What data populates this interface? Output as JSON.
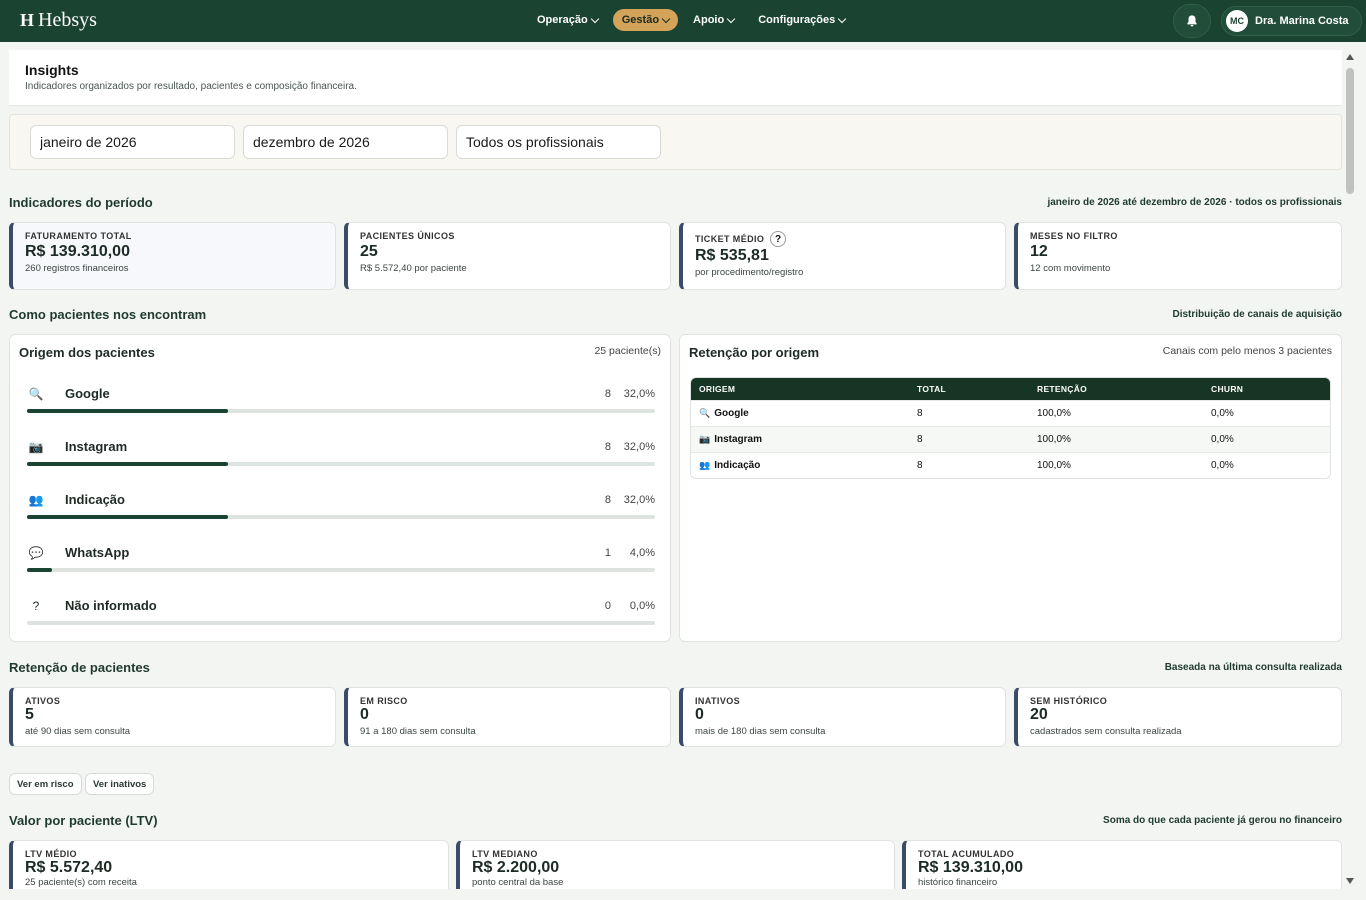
{
  "app": {
    "brand": "Hebsys",
    "brand_mark": "H",
    "nav": [
      {
        "label": "Operação"
      },
      {
        "label": "Gestão"
      },
      {
        "label": "Apoio"
      },
      {
        "label": "Configurações"
      }
    ],
    "user": {
      "initials": "MC",
      "name": "Dra. Marina Costa"
    }
  },
  "colors": {
    "brand": "#1b4332",
    "accent": "#d4a35a"
  },
  "header": {
    "title": "Insights",
    "subtitle": "Indicadores organizados por resultado, pacientes e composição financeira."
  },
  "filters": {
    "start": "janeiro de 2026",
    "end": "dezembro de 2026",
    "professional": "Todos os profissionais"
  },
  "period": {
    "title": "Indicadores do período",
    "note": "janeiro de 2026 até dezembro de 2026 · todos os profissionais",
    "kpis": [
      {
        "label": "FATURAMENTO TOTAL",
        "value": "R$ 139.310,00",
        "sub": "260 registros financeiros"
      },
      {
        "label": "PACIENTES ÚNICOS",
        "value": "25",
        "sub": "R$ 5.572,40 por paciente"
      },
      {
        "label": "TICKET MÉDIO",
        "help": "?",
        "value": "R$ 535,81",
        "sub": "por procedimento/registro"
      },
      {
        "label": "MESES NO FILTRO",
        "value": "12",
        "sub": "12 com movimento"
      }
    ]
  },
  "acquisition": {
    "title": "Como pacientes nos encontram",
    "note": "Distribuição de canais de aquisição",
    "origins": {
      "title": "Origem dos pacientes",
      "meta": "25 paciente(s)",
      "items": [
        {
          "icon": "🔍",
          "icon_name": "search-icon",
          "name": "Google",
          "count": "8",
          "pct": "32,0%",
          "share": 0.32
        },
        {
          "icon": "📷",
          "icon_name": "camera-icon",
          "name": "Instagram",
          "count": "8",
          "pct": "32,0%",
          "share": 0.32
        },
        {
          "icon": "👥",
          "icon_name": "people-icon",
          "name": "Indicação",
          "count": "8",
          "pct": "32,0%",
          "share": 0.32
        },
        {
          "icon": "💬",
          "icon_name": "chat-icon",
          "name": "WhatsApp",
          "count": "1",
          "pct": "4,0%",
          "share": 0.04
        },
        {
          "icon": "?",
          "icon_name": "question-icon",
          "name": "Não informado",
          "count": "0",
          "pct": "0,0%",
          "share": 0.0
        }
      ]
    },
    "retention": {
      "title": "Retenção por origem",
      "meta": "Canais com pelo menos 3 pacientes",
      "columns": [
        "ORIGEM",
        "TOTAL",
        "RETENÇÃO",
        "CHURN"
      ],
      "rows": [
        {
          "icon": "🔍",
          "name": "Google",
          "total": "8",
          "retention": "100,0%",
          "churn": "0,0%"
        },
        {
          "icon": "📷",
          "name": "Instagram",
          "total": "8",
          "retention": "100,0%",
          "churn": "0,0%"
        },
        {
          "icon": "👥",
          "name": "Indicação",
          "total": "8",
          "retention": "100,0%",
          "churn": "0,0%"
        }
      ]
    }
  },
  "patient_retention": {
    "title": "Retenção de pacientes",
    "note": "Baseada na última consulta realizada",
    "kpis": [
      {
        "label": "ATIVOS",
        "value": "5",
        "sub": "até 90 dias sem consulta"
      },
      {
        "label": "EM RISCO",
        "value": "0",
        "sub": "91 a 180 dias sem consulta"
      },
      {
        "label": "INATIVOS",
        "value": "0",
        "sub": "mais de 180 dias sem consulta"
      },
      {
        "label": "SEM HISTÓRICO",
        "value": "20",
        "sub": "cadastrados sem consulta realizada"
      }
    ],
    "buttons": {
      "risk": "Ver em risco",
      "inactive": "Ver inativos"
    }
  },
  "ltv": {
    "title": "Valor por paciente (LTV)",
    "note": "Soma do que cada paciente já gerou no financeiro",
    "kpis": [
      {
        "label": "LTV MÉDIO",
        "value": "R$ 5.572,40",
        "sub": "25 paciente(s) com receita"
      },
      {
        "label": "LTV MEDIANO",
        "value": "R$ 2.200,00",
        "sub": "ponto central da base"
      },
      {
        "label": "TOTAL ACUMULADO",
        "value": "R$ 139.310,00",
        "sub": "histórico financeiro"
      }
    ]
  }
}
